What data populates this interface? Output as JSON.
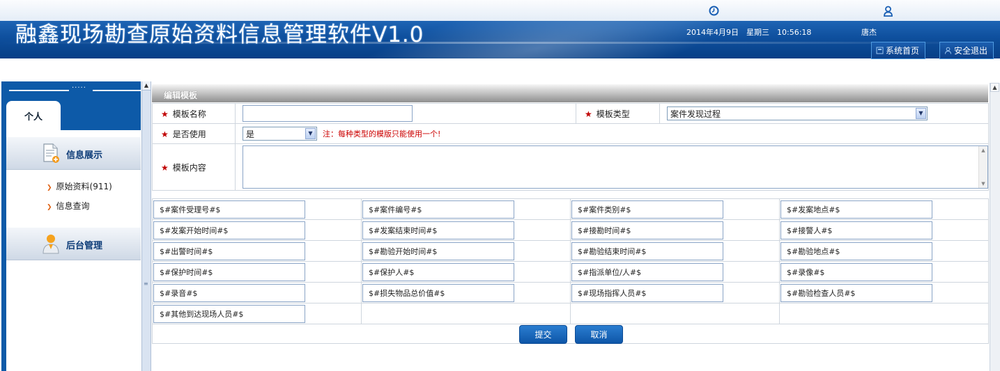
{
  "header": {
    "app_title": "融鑫现场勘查原始资料信息管理软件V1.0",
    "datetime": "2014年4月9日　星期三　10:56:18",
    "username": "唐杰",
    "home_button": "系统首页",
    "logout_button": "安全退出"
  },
  "sidebar": {
    "tab_label": "个人",
    "sections": [
      {
        "label": "信息展示",
        "icon": "document-add-icon"
      },
      {
        "label": "后台管理",
        "icon": "admin-user-icon"
      }
    ],
    "items": [
      {
        "label": "原始资料(911)"
      },
      {
        "label": "信息查询"
      }
    ]
  },
  "panel": {
    "title": "编辑模板",
    "fields": {
      "template_name_label": "模板名称",
      "template_name_value": "",
      "template_type_label": "模板类型",
      "template_type_value": "案件发现过程",
      "in_use_label": "是否使用",
      "in_use_value": "是",
      "in_use_note": "注：每种类型的模版只能使用一个!",
      "content_label": "模板内容",
      "content_value": ""
    },
    "tags": [
      [
        "$#案件受理号#$",
        "$#案件编号#$",
        "$#案件类别#$",
        "$#发案地点#$"
      ],
      [
        "$#发案开始时间#$",
        "$#发案结束时间#$",
        "$#接勘时间#$",
        "$#接警人#$"
      ],
      [
        "$#出警时间#$",
        "$#勘验开始时间#$",
        "$#勘验结束时间#$",
        "$#勘验地点#$"
      ],
      [
        "$#保护时间#$",
        "$#保护人#$",
        "$#指派单位/人#$",
        "$#录像#$"
      ],
      [
        "$#录音#$",
        "$#损失物品总价值#$",
        "$#现场指挥人员#$",
        "$#勘验检查人员#$"
      ],
      [
        "$#其他到达现场人员#$"
      ]
    ],
    "submit_button": "提交",
    "cancel_button": "取消"
  },
  "colors": {
    "banner": "#0e4f9d",
    "sidebar_accent": "#0d5aa8",
    "required_star": "#c00000",
    "note_red": "#cc0000"
  }
}
